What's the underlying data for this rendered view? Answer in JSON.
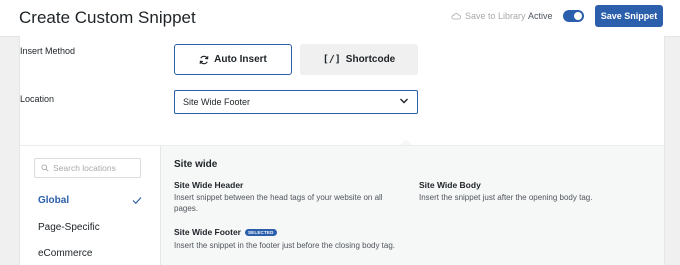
{
  "header": {
    "title": "Create Custom Snippet",
    "save_to_library": "Save to Library",
    "active_label": "Active",
    "active_on": true,
    "save_button": "Save Snippet",
    "accent_color": "#2c5fab"
  },
  "insert_method": {
    "label": "Insert Method",
    "auto_insert": "Auto Insert",
    "shortcode": "Shortcode",
    "shortcode_icon": "[/]",
    "selected": "Auto Insert"
  },
  "location": {
    "label": "Location",
    "value": "Site Wide Footer"
  },
  "sidebar": {
    "search_placeholder": "Search locations",
    "items": [
      {
        "label": "Global",
        "selected": true
      },
      {
        "label": "Page-Specific",
        "selected": false
      },
      {
        "label": "eCommerce",
        "selected": false
      }
    ]
  },
  "content": {
    "section_title": "Site wide",
    "options": [
      {
        "title": "Site Wide Header",
        "desc": "Insert snippet between the head tags of your website on all pages."
      },
      {
        "title": "Site Wide Body",
        "desc": "Insert the snippet just after the opening body tag."
      },
      {
        "title": "Site Wide Footer",
        "desc": "Insert the snippet in the footer just before the closing body tag.",
        "badge": "SELECTED"
      }
    ]
  }
}
